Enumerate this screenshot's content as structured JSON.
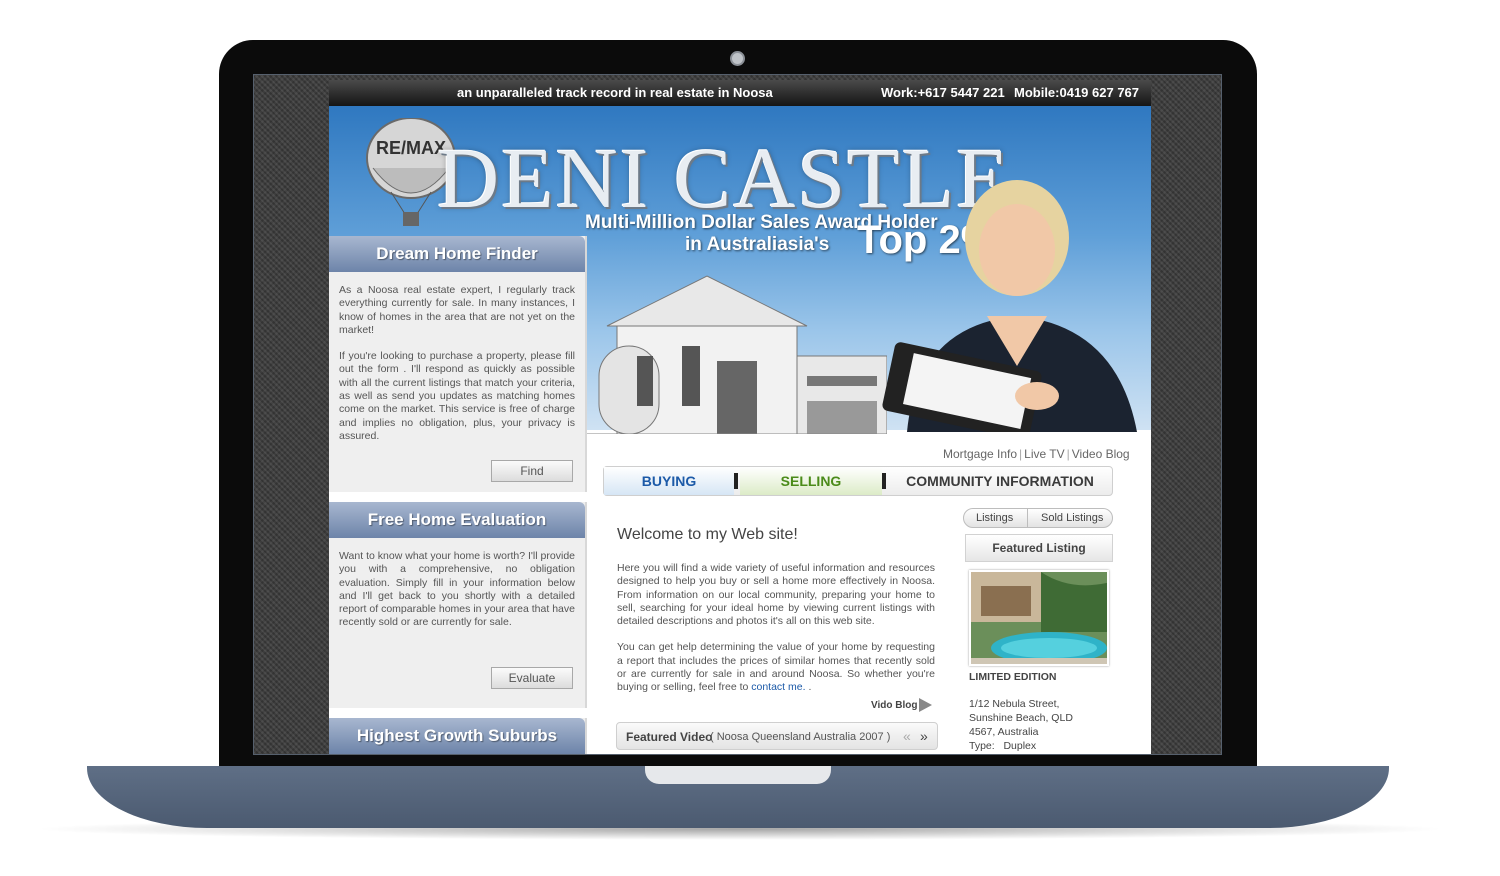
{
  "site": {
    "tagline": "an unparalleled track record in real estate in Noosa",
    "work_phone": "Work:+617 5447 221",
    "mobile_phone": "Mobile:0419 627 767",
    "logo_text": "RE/MAX",
    "brand_name": "DENI CASTLE",
    "award_line1": "Multi-Million Dollar Sales Award Holder",
    "award_line2": "in Australiasia's",
    "award_top": "Top 2%"
  },
  "sidebar": {
    "dream": {
      "title": "Dream Home Finder",
      "p1": "As a Noosa real estate expert, I regularly track everything currently for sale. In many instances, I know of homes in the area that are not yet on the market!",
      "p2": "If you're looking to purchase a property, please fill out the form . I'll respond as quickly as possible with all the current listings that match your criteria, as well as send you updates as matching homes come on the market. This service is free of charge and implies no obligation, plus, your privacy is assured.",
      "button": "Find"
    },
    "evaluation": {
      "title": "Free Home Evaluation",
      "p1": "Want to know what your home is worth? I'll provide you with a comprehensive, no obligation evaluation. Simply fill in your information below and I'll get back to you shortly with a detailed report of comparable homes in your area that have recently sold or are currently for sale.",
      "button": "Evaluate"
    },
    "growth": {
      "title": "Highest Growth Suburbs"
    }
  },
  "toplinks": {
    "mortgage": "Mortgage Info",
    "live_tv": "Live TV",
    "video_blog": "Video Blog"
  },
  "nav": {
    "buying": "BUYING",
    "selling": "SELLING",
    "community": "COMMUNITY INFORMATION"
  },
  "main": {
    "welcome": "Welcome to my Web site!",
    "p1": "Here you will find a wide variety of useful information and resources designed to help you buy or sell a home more effectively in Noosa. From information on our local community, preparing your home to sell, searching for your ideal home by viewing current listings with detailed descriptions and photos it's all on this web site.",
    "p2_text": "You can get help determining the value of your home by requesting a report that includes the prices of similar homes that recently sold or are currently for sale in and around Noosa.  So whether you're buying or selling, feel free to",
    "contact_link": "contact me.",
    "p2_end": " .",
    "vido_blog": "Vido Blog",
    "featured_video_title": "Featured Video",
    "featured_video_sub": "( Noosa Queensland Australia 2007 )"
  },
  "listings": {
    "tab1": "Listings",
    "tab2": "Sold Listings",
    "featured_title": "Featured Listing",
    "label": "LIMITED EDITION",
    "addr1": "1/12 Nebula Street,",
    "addr2": "Sunshine Beach, QLD",
    "addr3": "4567, Australia",
    "type_label": "Type:",
    "type_value": "Duplex"
  },
  "colors": {
    "panel_head": "#6d84a9",
    "buying": "#1c5aa8",
    "selling": "#4b8b1a",
    "laptop_base": "#4b5a70"
  }
}
